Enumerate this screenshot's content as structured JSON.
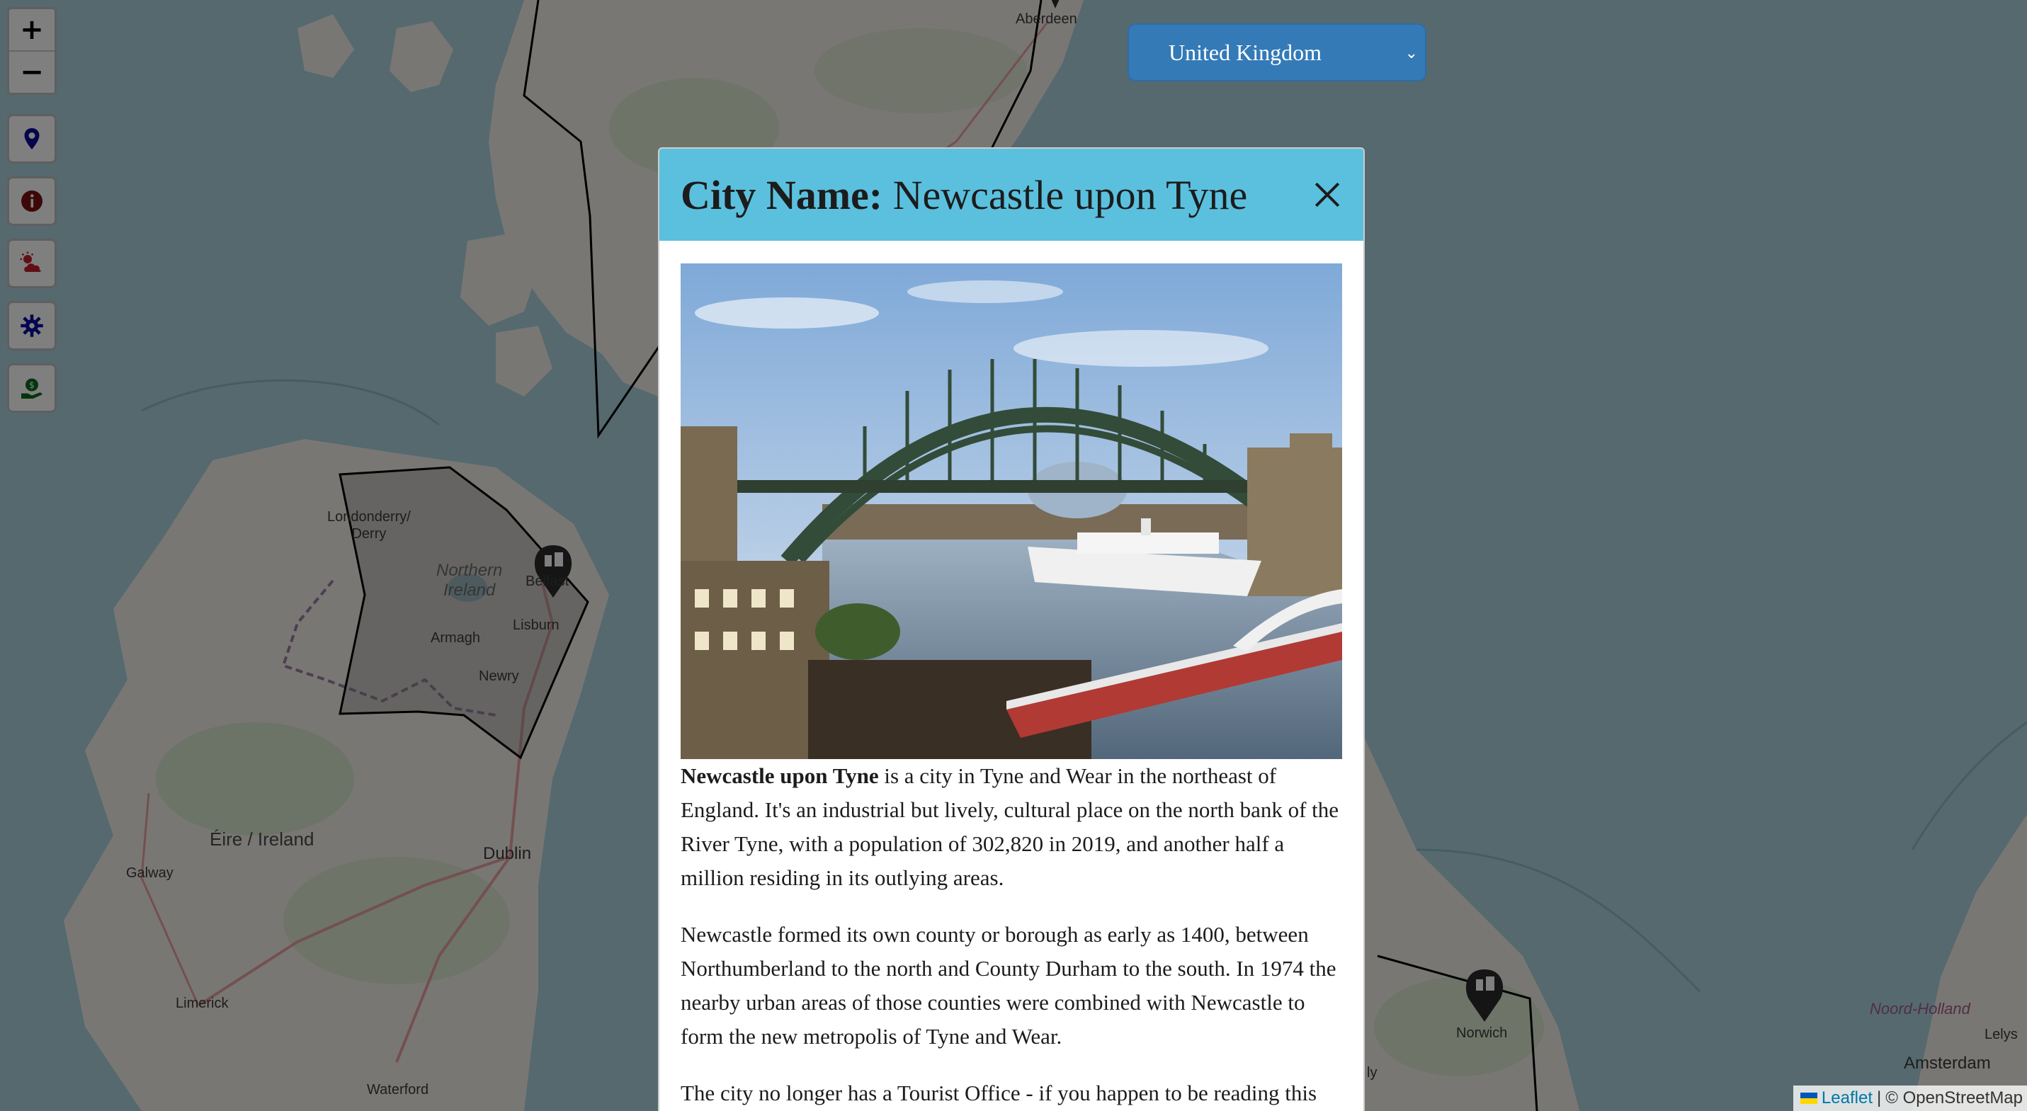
{
  "map": {
    "labels": {
      "aberdeen": "Aberdeen",
      "londonderry": "Londonderry/\nDerry",
      "northern_ireland": "Northern\nIreland",
      "belfast": "Belfast",
      "armagh": "Armagh",
      "lisburn": "Lisburn",
      "newry": "Newry",
      "eire": "Éire / Ireland",
      "dublin": "Dublin",
      "galway": "Galway",
      "limerick": "Limerick",
      "waterford": "Waterford",
      "norwich": "Norwich",
      "noord_holland": "Noord-Holland",
      "amsterdam": "Amsterdam",
      "lelystad": "Lelys",
      "partial_ly": "ly"
    }
  },
  "controls": {
    "zoom_in": "+",
    "zoom_out": "−"
  },
  "country_select": {
    "selected": "United Kingdom"
  },
  "attribution": {
    "leaflet": "Leaflet",
    "separator": "|",
    "osm": "© OpenStreetMap"
  },
  "modal": {
    "title_label": "City Name:",
    "city_name": "Newcastle upon Tyne",
    "paragraph1": {
      "bold": "Newcastle upon Tyne",
      "rest": " is a city in Tyne and Wear in the northeast of England. It's an industrial but lively, cultural place on the north bank of the River Tyne, with a population of 302,820 in 2019, and another half a million residing in its outlying areas."
    },
    "paragraph2": "Newcastle formed its own county or borough as early as 1400, between Northumberland to the north and County Durham to the south. In 1974 the nearby urban areas of those counties were combined with Newcastle to form the new metropolis of Tyne and Wear.",
    "paragraph3": "The city no longer has a Tourist Office - if you happen to be reading this"
  },
  "colors": {
    "modal_header": "#5bc0de",
    "select_bg": "#337ab7",
    "marker": "#2b2b2b"
  }
}
